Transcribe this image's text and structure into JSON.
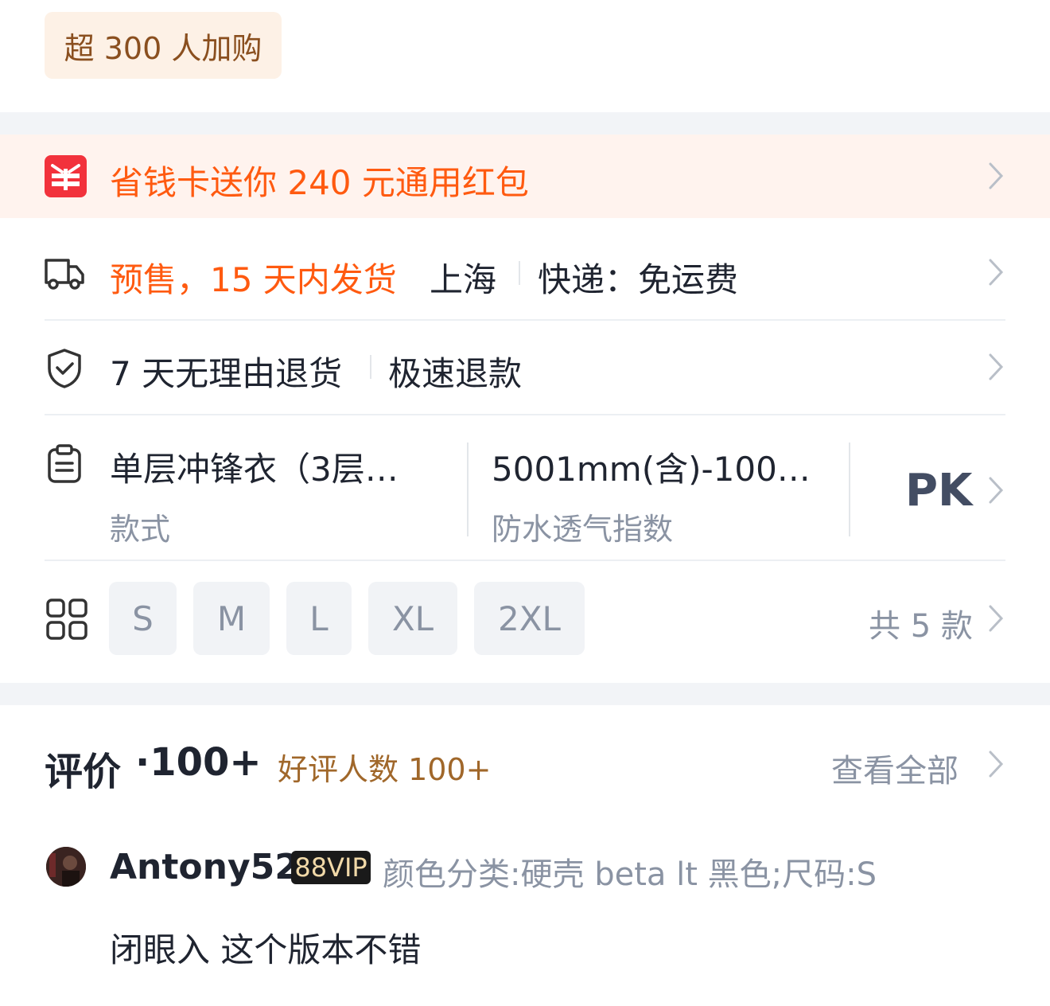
{
  "buy_tag": "超 300 人加购",
  "promo": {
    "text": "省钱卡送你 240 元通用红包",
    "icon": "red-packet-icon"
  },
  "shipping": {
    "presale": "预售，15 天内发货",
    "origin": "上海",
    "express": "快递：免运费",
    "icon": "delivery-truck-icon"
  },
  "returns": {
    "policy": "7 天无理由退货",
    "refund": "极速退款",
    "icon": "shield-check-icon"
  },
  "specs": {
    "icon": "clipboard-icon",
    "items": [
      {
        "value": "单层冲锋衣（3层…",
        "label": "款式"
      },
      {
        "value": "5001mm(含)-100…",
        "label": "防水透气指数"
      }
    ],
    "pk_label": "PK"
  },
  "sizes": {
    "icon": "grid-icon",
    "options": [
      "S",
      "M",
      "L",
      "XL",
      "2XL"
    ],
    "total": "共 5 款"
  },
  "reviews": {
    "title": "评价",
    "count": "·100+",
    "good_count": "好评人数 100+",
    "view_all": "查看全部",
    "first": {
      "username": "Antony52",
      "badge": "88VIP",
      "sku": "颜色分类:硬壳 beta lt 黑色;尺码:S",
      "content": "闭眼入 这个版本不错"
    }
  },
  "colors": {
    "accent_orange": "#ff5a10",
    "promo_red": "#f2323c",
    "text_dark": "#1f2430",
    "text_gray": "#8a93a3",
    "gold": "#a0672a"
  }
}
